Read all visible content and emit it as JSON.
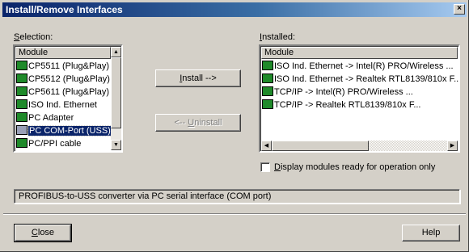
{
  "window": {
    "title": "Install/Remove Interfaces",
    "close_glyph": "×"
  },
  "selection": {
    "label": "Selection:",
    "column": "Module",
    "items": [
      {
        "label": "CP5511 (Plug&Play)",
        "icon": "module-icon",
        "selected": false
      },
      {
        "label": "CP5512 (Plug&Play)",
        "icon": "module-icon",
        "selected": false
      },
      {
        "label": "CP5611 (Plug&Play)",
        "icon": "module-icon",
        "selected": false
      },
      {
        "label": "ISO Ind. Ethernet",
        "icon": "module-icon",
        "selected": false
      },
      {
        "label": "PC Adapter",
        "icon": "module-icon",
        "selected": false
      },
      {
        "label": "PC COM-Port (USS)",
        "icon": "com-port-icon",
        "selected": true
      },
      {
        "label": "PC/PPI cable",
        "icon": "module-icon",
        "selected": false
      }
    ]
  },
  "installed": {
    "label": "Installed:",
    "column": "Module",
    "items": [
      {
        "label": "ISO Ind. Ethernet -> Intel(R) PRO/Wireless ...",
        "icon": "module-icon"
      },
      {
        "label": "ISO Ind. Ethernet -> Realtek RTL8139/810x F...",
        "icon": "module-warning-icon"
      },
      {
        "label": "TCP/IP -> Intel(R) PRO/Wireless ...",
        "icon": "module-icon"
      },
      {
        "label": "TCP/IP -> Realtek RTL8139/810x F...",
        "icon": "module-warning-icon"
      }
    ]
  },
  "buttons": {
    "install": "Install -->",
    "uninstall": "<-- Uninstall",
    "close": "Close",
    "help": "Help"
  },
  "checkbox": {
    "label": "Display modules ready for operation only",
    "checked": false
  },
  "status": "PROFIBUS-to-USS converter via PC serial interface (COM port)",
  "colors": {
    "title_start": "#0a246a",
    "title_end": "#a6caf0",
    "selection": "#0a246a",
    "face": "#d4d0c8"
  }
}
